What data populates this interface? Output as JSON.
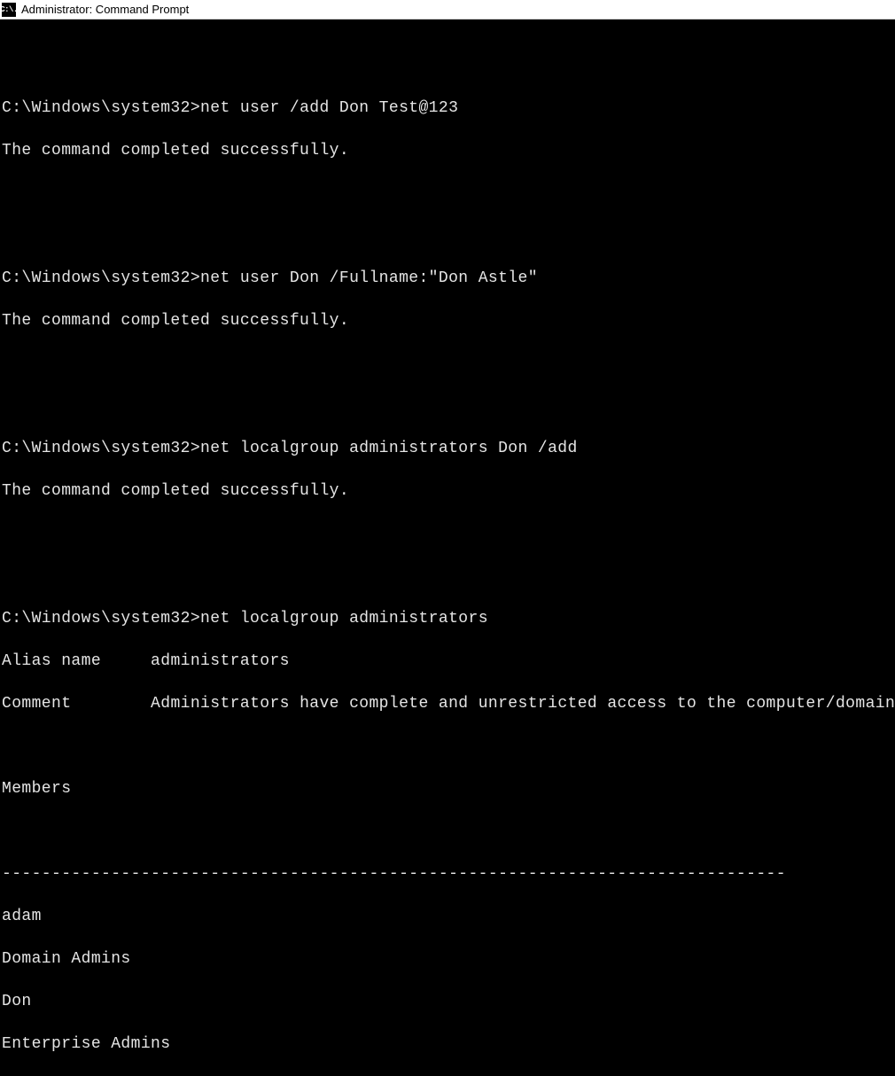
{
  "title": "Administrator: Command Prompt",
  "sysicon_text": "C:\\.",
  "prompt": "C:\\Windows\\system32>",
  "entries": [
    {
      "cmd": "net user /add Don Test@123",
      "result": "The command completed successfully."
    },
    {
      "cmd": "net user Don /Fullname:\"Don Astle\"",
      "result": "The command completed successfully."
    },
    {
      "cmd": "net localgroup administrators Don /add",
      "result": "The command completed successfully."
    }
  ],
  "listing": {
    "cmd": "net localgroup administrators",
    "alias_label": "Alias name",
    "alias_value": "administrators",
    "comment_label": "Comment",
    "comment_value": "Administrators have complete and unrestricted access to the computer/domain",
    "members_label": "Members",
    "rule": "-------------------------------------------------------------------------------",
    "members": [
      "adam",
      "Domain Admins",
      "Don",
      "Enterprise Admins"
    ]
  }
}
